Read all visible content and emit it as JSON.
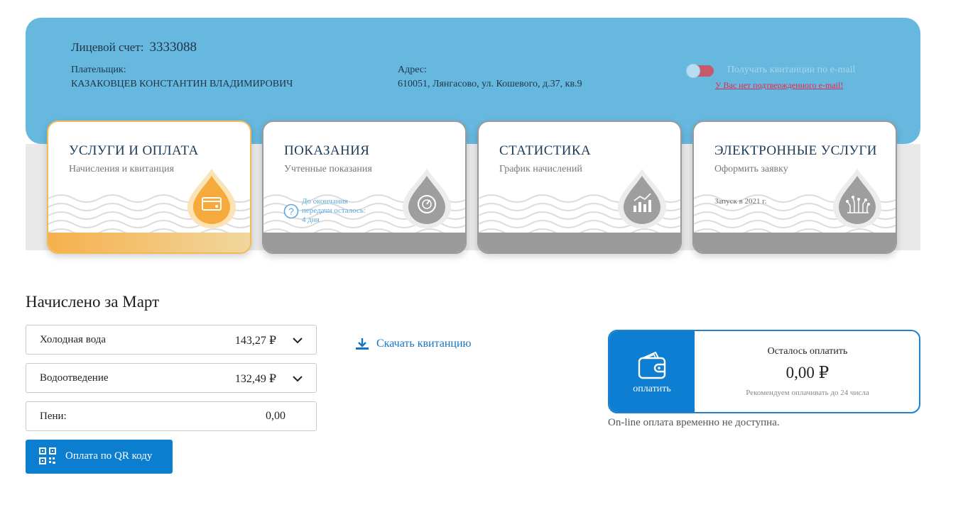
{
  "account": {
    "label": "Лицевой счет:",
    "number": "3333088",
    "payer_label": "Плательщик:",
    "payer_name": "КАЗАКОВЦЕВ КОНСТАНТИН ВЛАДИМИРОВИЧ",
    "address_label": "Адрес:",
    "address_value": "610051, Лянгасово, ул. Кошевого, д.37, кв.9",
    "email_toggle_label": "Получать квитанции по e-mail",
    "email_toggle_on": false,
    "email_warning": "У Вас нет подтвержденного e-mail!"
  },
  "tiles": [
    {
      "title": "УСЛУГИ И ОПЛАТА",
      "subtitle": "Начисления и квитанция",
      "icon": "payment-card-icon",
      "active": true
    },
    {
      "title": "ПОКАЗАНИЯ",
      "subtitle": "Учтенные показания",
      "icon": "meter-gauge-icon",
      "note": "До окончания передачи осталось: 4 дня",
      "note_lines": [
        "До окончания",
        "передачи осталось:",
        "4 дня"
      ]
    },
    {
      "title": "СТАТИСТИКА",
      "subtitle": "График начислений",
      "icon": "statistics-chart-icon"
    },
    {
      "title": "ЭЛЕКТРОННЫЕ УСЛУГИ",
      "subtitle": "Оформить заявку",
      "icon": "circuit-icon",
      "note": "Запуск в 2021 г."
    }
  ],
  "charges": {
    "title": "Начислено за Март",
    "rows": [
      {
        "name": "Холодная вода",
        "amount": "143,27 ₽",
        "expandable": true
      },
      {
        "name": "Водоотведение",
        "amount": "132,49 ₽",
        "expandable": true
      },
      {
        "name": "Пени:",
        "amount": "0,00",
        "expandable": false
      }
    ],
    "qr_button": "Оплата по QR коду",
    "download_link": "Скачать квитанцию"
  },
  "payment": {
    "button_label": "оплатить",
    "remaining_label": "Осталось оплатить",
    "remaining_amount": "0,00 ₽",
    "recommendation": "Рекомендуем оплачивать до 24 числа",
    "offline_note": "On-line оплата временно не доступна."
  },
  "colors": {
    "header_bg": "#67b8df",
    "accent_blue": "#0c7ecf",
    "active_tile": "#f6b04c",
    "inactive_gray": "#9a9a9a",
    "warning_red": "#e0284a"
  }
}
